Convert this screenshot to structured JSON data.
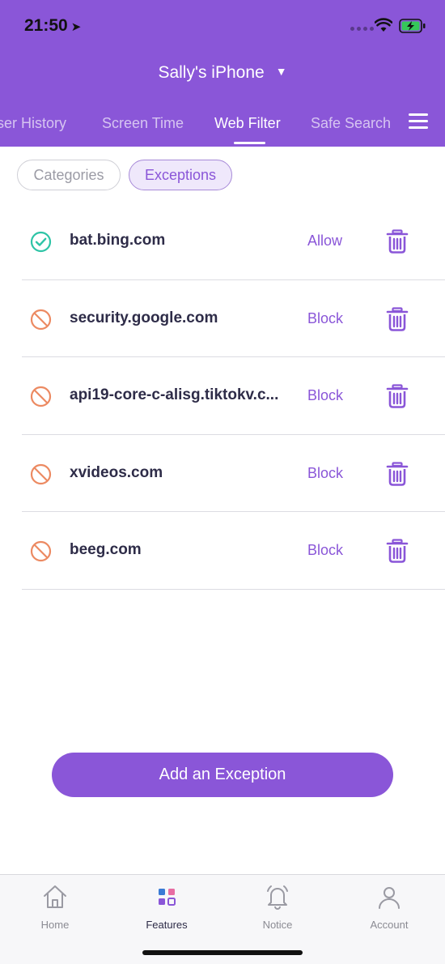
{
  "status_bar": {
    "time": "21:50",
    "location_icon": "location-arrow-icon",
    "wifi_icon": "wifi-icon",
    "battery_icon": "battery-charging-icon"
  },
  "header": {
    "device_name": "Sally's iPhone",
    "tabs": [
      {
        "label": "ser History"
      },
      {
        "label": "Screen Time"
      },
      {
        "label": "Web Filter"
      },
      {
        "label": "Safe Search"
      }
    ],
    "active_tab": "Web Filter",
    "menu_icon": "hamburger-menu-icon"
  },
  "segments": {
    "categories": "Categories",
    "exceptions": "Exceptions",
    "selected": "Exceptions"
  },
  "exceptions": [
    {
      "domain": "bat.bing.com",
      "action": "Allow",
      "status": "allow"
    },
    {
      "domain": "security.google.com",
      "action": "Block",
      "status": "block"
    },
    {
      "domain": "api19-core-c-alisg.tiktokv.c...",
      "action": "Block",
      "status": "block"
    },
    {
      "domain": "xvideos.com",
      "action": "Block",
      "status": "block"
    },
    {
      "domain": "beeg.com",
      "action": "Block",
      "status": "block"
    }
  ],
  "add_button": {
    "label": "Add an Exception"
  },
  "tabbar": {
    "items": [
      {
        "label": "Home",
        "icon": "home-icon"
      },
      {
        "label": "Features",
        "icon": "features-grid-icon"
      },
      {
        "label": "Notice",
        "icon": "bell-icon"
      },
      {
        "label": "Account",
        "icon": "person-icon"
      }
    ],
    "active": "Features"
  },
  "colors": {
    "accent": "#8a56d8",
    "allow": "#2ec4a6",
    "block": "#ec8a62",
    "text": "#2e2c48"
  }
}
